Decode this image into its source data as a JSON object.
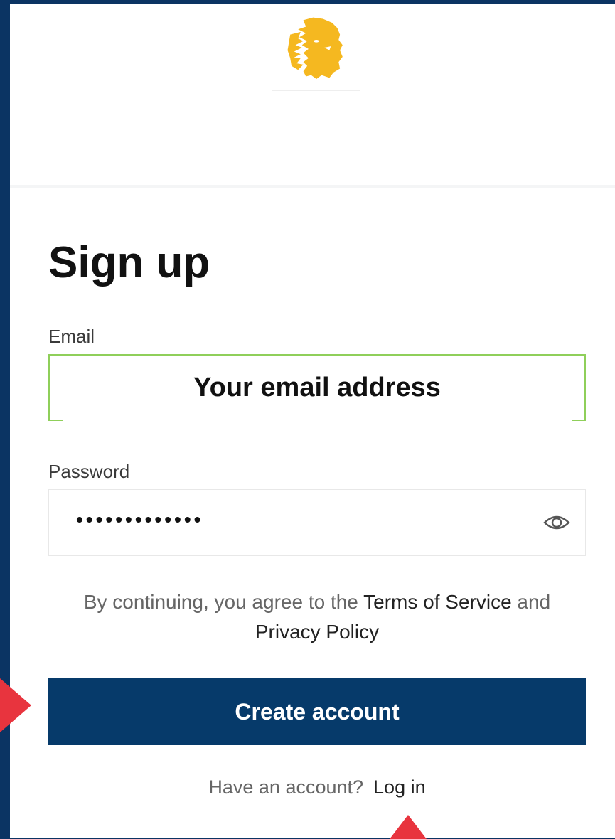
{
  "brand": {
    "logo_icon": "lion-head-icon",
    "logo_color": "#f5b820"
  },
  "form": {
    "title": "Sign up",
    "email": {
      "label": "Email",
      "placeholder": "Your email address"
    },
    "password": {
      "label": "Password",
      "value": "•••••••••••••",
      "toggle_icon": "eye-icon"
    },
    "terms": {
      "prefix": "By continuing, you agree to the ",
      "terms_link": "Terms of Service",
      "middle": " and",
      "privacy_link": "Privacy Policy"
    },
    "submit_label": "Create account",
    "login_prompt": "Have an account?",
    "login_link": "Log in"
  },
  "colors": {
    "primary": "#063a6a",
    "page_bg": "#0b3463",
    "focus_border": "#8fcf5a",
    "annotation_arrow": "#e8343e"
  }
}
